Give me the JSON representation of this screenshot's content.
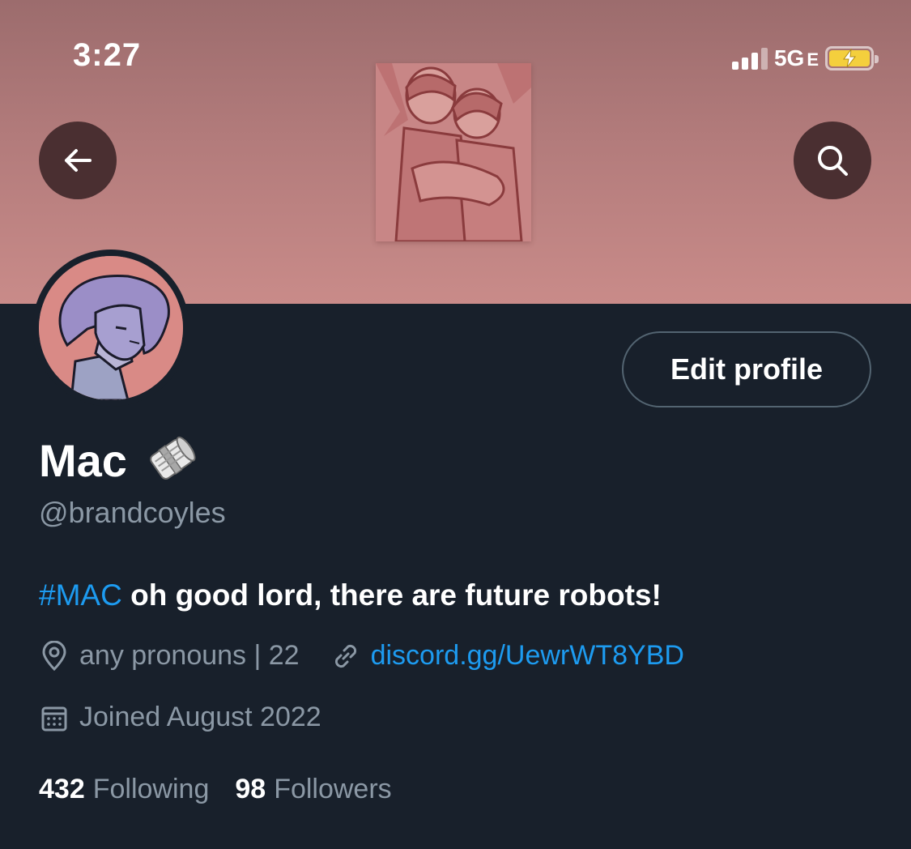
{
  "status_bar": {
    "time": "3:27",
    "network": "5G",
    "network_suffix": "E",
    "battery_icon": "battery-charging-icon"
  },
  "banner": {
    "background_color": "#b27b7b",
    "image_icon": "banner-illustration"
  },
  "header": {
    "back_icon": "arrow-left-icon",
    "search_icon": "search-icon"
  },
  "profile": {
    "name": "Mac",
    "name_emoji_icon": "rolled-newspaper-icon",
    "handle": "@brandcoyles",
    "edit_button_label": "Edit profile",
    "bio_hashtag": "#MAC",
    "bio_text": " oh good lord, there are future robots!",
    "location": "any pronouns | 22",
    "website": "discord.gg/UewrWT8YBD",
    "joined": "Joined August 2022"
  },
  "stats": {
    "following_count": "432",
    "following_label": "Following",
    "followers_count": "98",
    "followers_label": "Followers"
  },
  "colors": {
    "background": "#18202b",
    "link": "#1d9bf0",
    "secondary_text": "#8b98a5",
    "button_border": "#536471",
    "battery": "#f4cf3d"
  }
}
